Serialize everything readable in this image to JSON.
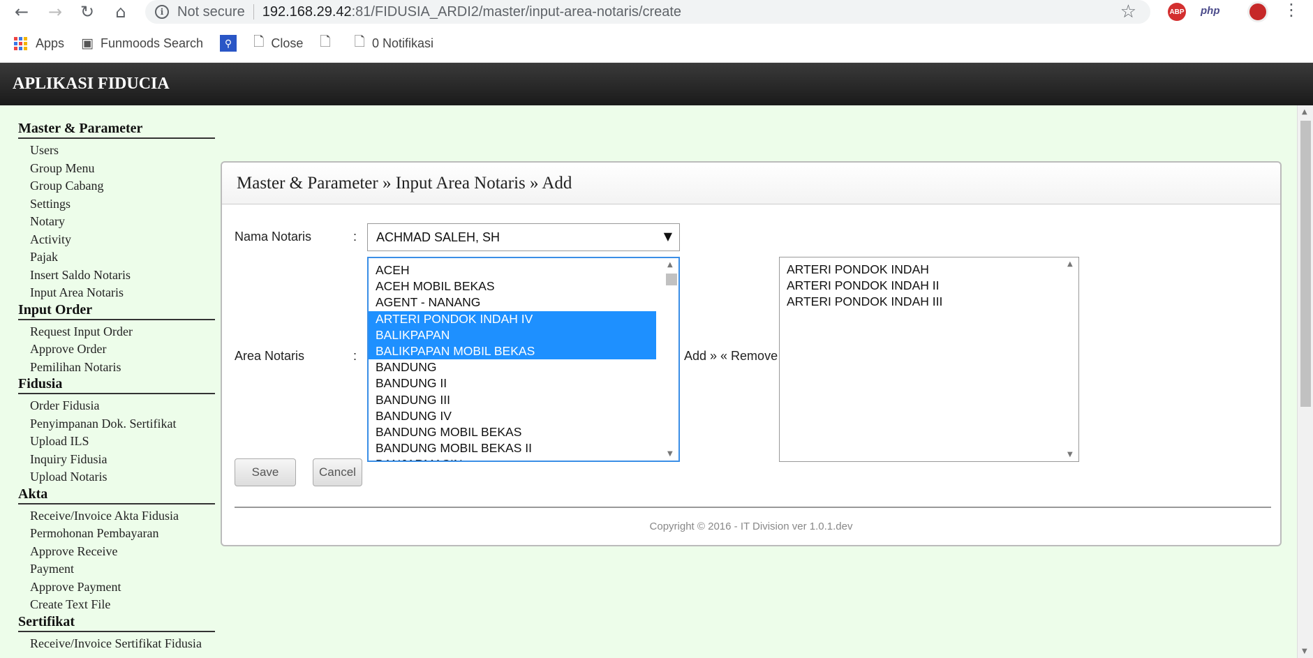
{
  "browser": {
    "not_secure": "Not secure",
    "url_host": "192.168.29.42",
    "url_rest": ":81/FIDUSIA_ARDI2/master/input-area-notaris/create",
    "ext_abp": "ABP",
    "ext_php": "php",
    "icons": {
      "back": "back-arrow-icon",
      "forward": "forward-arrow-icon",
      "reload": "reload-icon",
      "home": "home-icon",
      "star": "star-icon",
      "menu": "menu-dots-icon"
    }
  },
  "bookmarks": {
    "apps": "Apps",
    "funmoods": "Funmoods Search",
    "close": "Close",
    "notif": "0 Notifikasi"
  },
  "app": {
    "title": "APLIKASI FIDUCIA"
  },
  "sidebar": {
    "sections": [
      {
        "title": "Master & Parameter",
        "items": [
          "Users",
          "Group Menu",
          "Group Cabang",
          "Settings",
          "Notary",
          "Activity",
          "Pajak",
          "Insert Saldo Notaris",
          "Input Area Notaris"
        ]
      },
      {
        "title": "Input Order",
        "items": [
          "Request Input Order",
          "Approve Order",
          "Pemilihan Notaris"
        ]
      },
      {
        "title": "Fidusia",
        "items": [
          "Order Fidusia",
          "Penyimpanan Dok. Sertifikat",
          "Upload ILS",
          "Inquiry Fidusia",
          "Upload Notaris"
        ]
      },
      {
        "title": "Akta",
        "items": [
          "Receive/Invoice Akta Fidusia",
          "Permohonan Pembayaran",
          "Approve Receive",
          "Payment",
          "Approve Payment",
          "Create Text File"
        ]
      },
      {
        "title": "Sertifikat",
        "items": [
          "Receive/Invoice Sertifikat Fidusia"
        ]
      }
    ]
  },
  "panel": {
    "breadcrumb": "Master & Parameter » Input Area Notaris » Add",
    "nama_label": "Nama Notaris",
    "area_label": "Area Notaris",
    "colon": ":",
    "nama_value": "ACHMAD SALEH, SH",
    "available_areas": [
      {
        "label": "ACEH",
        "selected": false
      },
      {
        "label": "ACEH MOBIL BEKAS",
        "selected": false
      },
      {
        "label": "AGENT - NANANG",
        "selected": false
      },
      {
        "label": "ARTERI PONDOK INDAH IV",
        "selected": true
      },
      {
        "label": "BALIKPAPAN",
        "selected": true
      },
      {
        "label": "BALIKPAPAN MOBIL BEKAS",
        "selected": true
      },
      {
        "label": "BANDUNG",
        "selected": false
      },
      {
        "label": "BANDUNG II",
        "selected": false
      },
      {
        "label": "BANDUNG III",
        "selected": false
      },
      {
        "label": "BANDUNG IV",
        "selected": false
      },
      {
        "label": "BANDUNG MOBIL BEKAS",
        "selected": false
      },
      {
        "label": "BANDUNG MOBIL BEKAS II",
        "selected": false
      },
      {
        "label": "BANJARMASIN",
        "selected": false
      }
    ],
    "assigned_areas": [
      "ARTERI PONDOK INDAH",
      "ARTERI PONDOK INDAH II",
      "ARTERI PONDOK INDAH III"
    ],
    "add_remove": "Add » « Remove",
    "save": "Save",
    "cancel": "Cancel",
    "copyright": "Copyright © 2016 - IT Division ver 1.0.1.dev"
  },
  "colors": {
    "selected_bg": "#1e90ff",
    "page_bg": "#edfdea",
    "header_bg": "#222222"
  }
}
